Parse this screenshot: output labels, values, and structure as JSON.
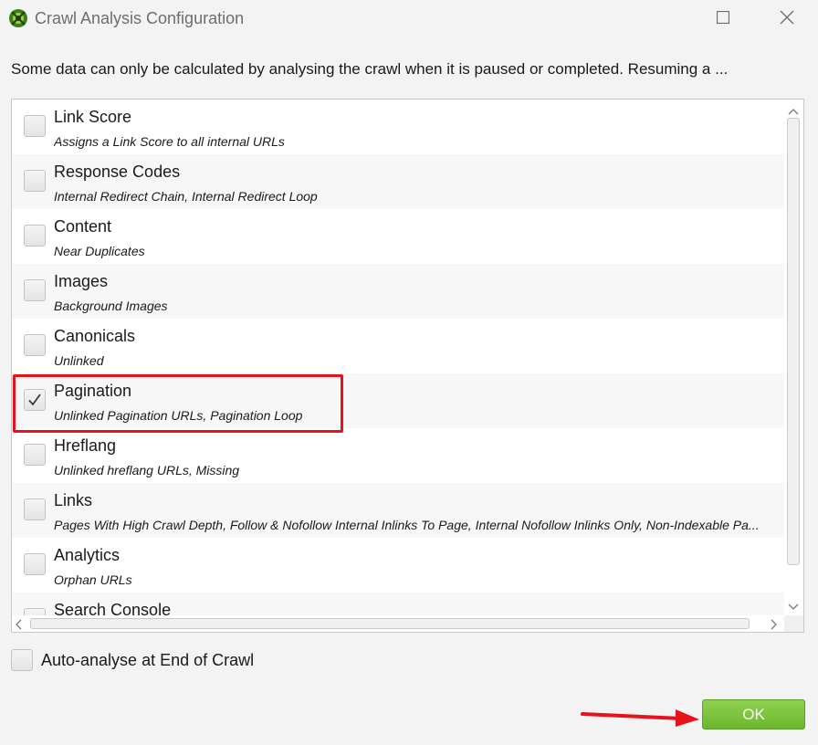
{
  "window": {
    "title": "Crawl Analysis Configuration",
    "icons": [
      "app-spider-icon",
      "maximize-icon",
      "close-icon"
    ]
  },
  "intro_text": "Some data can only be calculated by analysing the crawl when it is paused or completed. Resuming a ...",
  "items": [
    {
      "label": "Link Score",
      "desc": "Assigns a Link Score to all internal URLs",
      "checked": false
    },
    {
      "label": "Response Codes",
      "desc": "Internal Redirect Chain, Internal Redirect Loop",
      "checked": false
    },
    {
      "label": "Content",
      "desc": "Near Duplicates",
      "checked": false
    },
    {
      "label": "Images",
      "desc": "Background Images",
      "checked": false
    },
    {
      "label": "Canonicals",
      "desc": "Unlinked",
      "checked": false
    },
    {
      "label": "Pagination",
      "desc": "Unlinked Pagination URLs, Pagination Loop",
      "checked": true
    },
    {
      "label": "Hreflang",
      "desc": "Unlinked hreflang URLs, Missing",
      "checked": false
    },
    {
      "label": "Links",
      "desc": "Pages With High Crawl Depth, Follow & Nofollow Internal Inlinks To Page, Internal Nofollow Inlinks Only, Non-Indexable Pa...",
      "checked": false
    },
    {
      "label": "Analytics",
      "desc": "Orphan URLs",
      "checked": false
    },
    {
      "label": "Search Console",
      "desc": "",
      "checked": false
    }
  ],
  "auto_analyse": {
    "label": "Auto-analyse at End of Crawl",
    "checked": false
  },
  "ok_button": {
    "label": "OK"
  },
  "colors": {
    "highlight": "#e8121b",
    "ok_green": "#6cb730",
    "annotation_arrow": "#e8121b"
  }
}
